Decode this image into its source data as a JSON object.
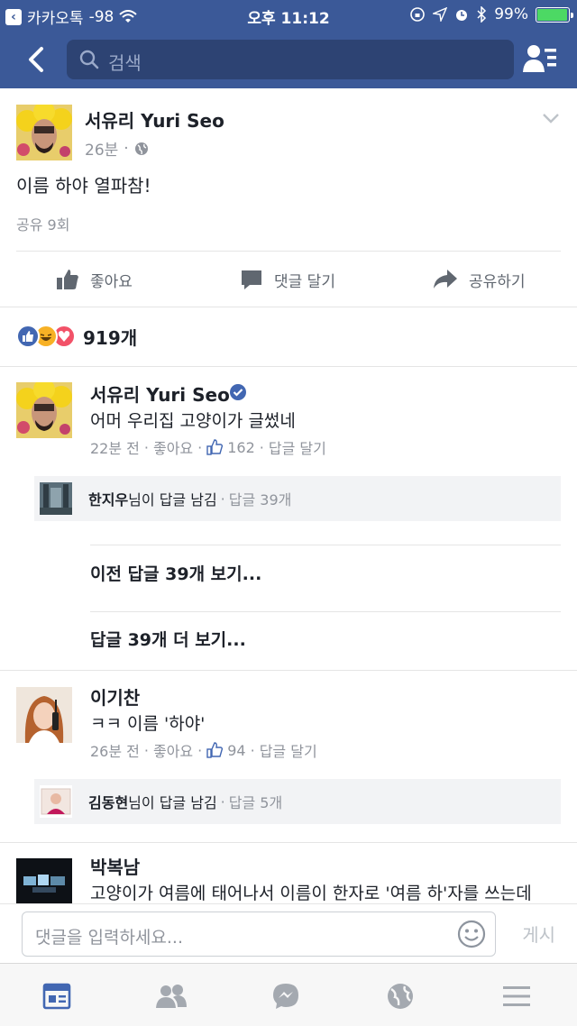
{
  "status_bar": {
    "back_app": "카카오톡",
    "signal": "-98",
    "time": "오후 11:12",
    "battery": "99%"
  },
  "nav": {
    "search_placeholder": "검색"
  },
  "post": {
    "author": "서유리 Yuri Seo",
    "time": "26분",
    "text": "이름 하야 열파참!",
    "shares": "공유 9회",
    "actions": {
      "like": "좋아요",
      "comment": "댓글 달기",
      "share": "공유하기"
    },
    "reactions_count": "919개"
  },
  "comments": [
    {
      "author": "서유리 Yuri Seo",
      "verified": true,
      "text": "어머 우리집 고양이가 글썼네",
      "time": "22분 전",
      "like": "좋아요",
      "likes": "162",
      "reply": "답글 달기",
      "reply_preview": {
        "name": "한지우",
        "suffix": "님이 답글 남김",
        "count": "답글 39개"
      },
      "prev_replies": "이전 답글 39개 보기...",
      "more_replies": "답글 39개 더 보기..."
    },
    {
      "author": "이기찬",
      "text": "ㅋㅋ 이름 '하야'",
      "time": "26분 전",
      "like": "좋아요",
      "likes": "94",
      "reply": "답글 달기",
      "reply_preview": {
        "name": "김동현",
        "suffix": "님이 답글 남김",
        "count": "답글 5개"
      }
    },
    {
      "author": "박복남",
      "text": "고양이가 여름에 태어나서 이름이 한자로 '여름 하'자를 쓰는데"
    }
  ],
  "composer": {
    "placeholder": "댓글을 입력하세요...",
    "post_label": "게시"
  },
  "tabs": [
    "news-feed",
    "friends",
    "messenger",
    "notifications-globe",
    "menu"
  ],
  "colors": {
    "brand": "#3b5998",
    "link_blue": "#4267b2",
    "gray_text": "#90949c"
  }
}
